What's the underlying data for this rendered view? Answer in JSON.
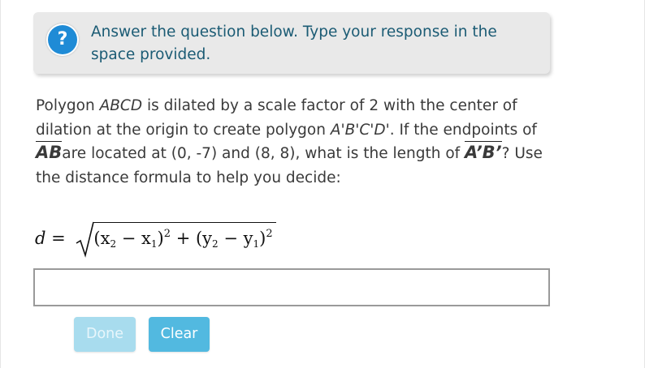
{
  "instruction_banner": {
    "icon": "help-icon",
    "icon_glyph": "?",
    "icon_color": "#1f8bd6",
    "text": "Answer the question below. Type your response in the space provided."
  },
  "question": {
    "part1": "Polygon ",
    "polygon_name": "ABCD",
    "part2": " is dilated by a scale factor of 2 with the center of dilation at the origin to create polygon ",
    "image_name": "A'B'C'D'",
    "part3": ". If the endpoints of ",
    "segment": "AB",
    "part4": "are located at (0, -7) and (8, 8), what is the length of ",
    "image_segment": "A’B’",
    "part5": "? Use the distance formula to help you decide:"
  },
  "formula": {
    "lhs": "d =",
    "open_paren_1": "(x",
    "sub_x2": "2",
    "minus_1": " − x",
    "sub_x1": "1",
    "close_paren_1": ")",
    "sq_1": "2",
    "plus": " + (y",
    "sub_y2": "2",
    "minus_2": " − y",
    "sub_y1": "1",
    "close_paren_2": ")",
    "sq_2": "2"
  },
  "answer_field": {
    "value": "",
    "placeholder": ""
  },
  "buttons": {
    "done_label": "Done",
    "clear_label": "Clear",
    "done_color": "#a8dcee",
    "clear_color": "#52b9e0"
  }
}
